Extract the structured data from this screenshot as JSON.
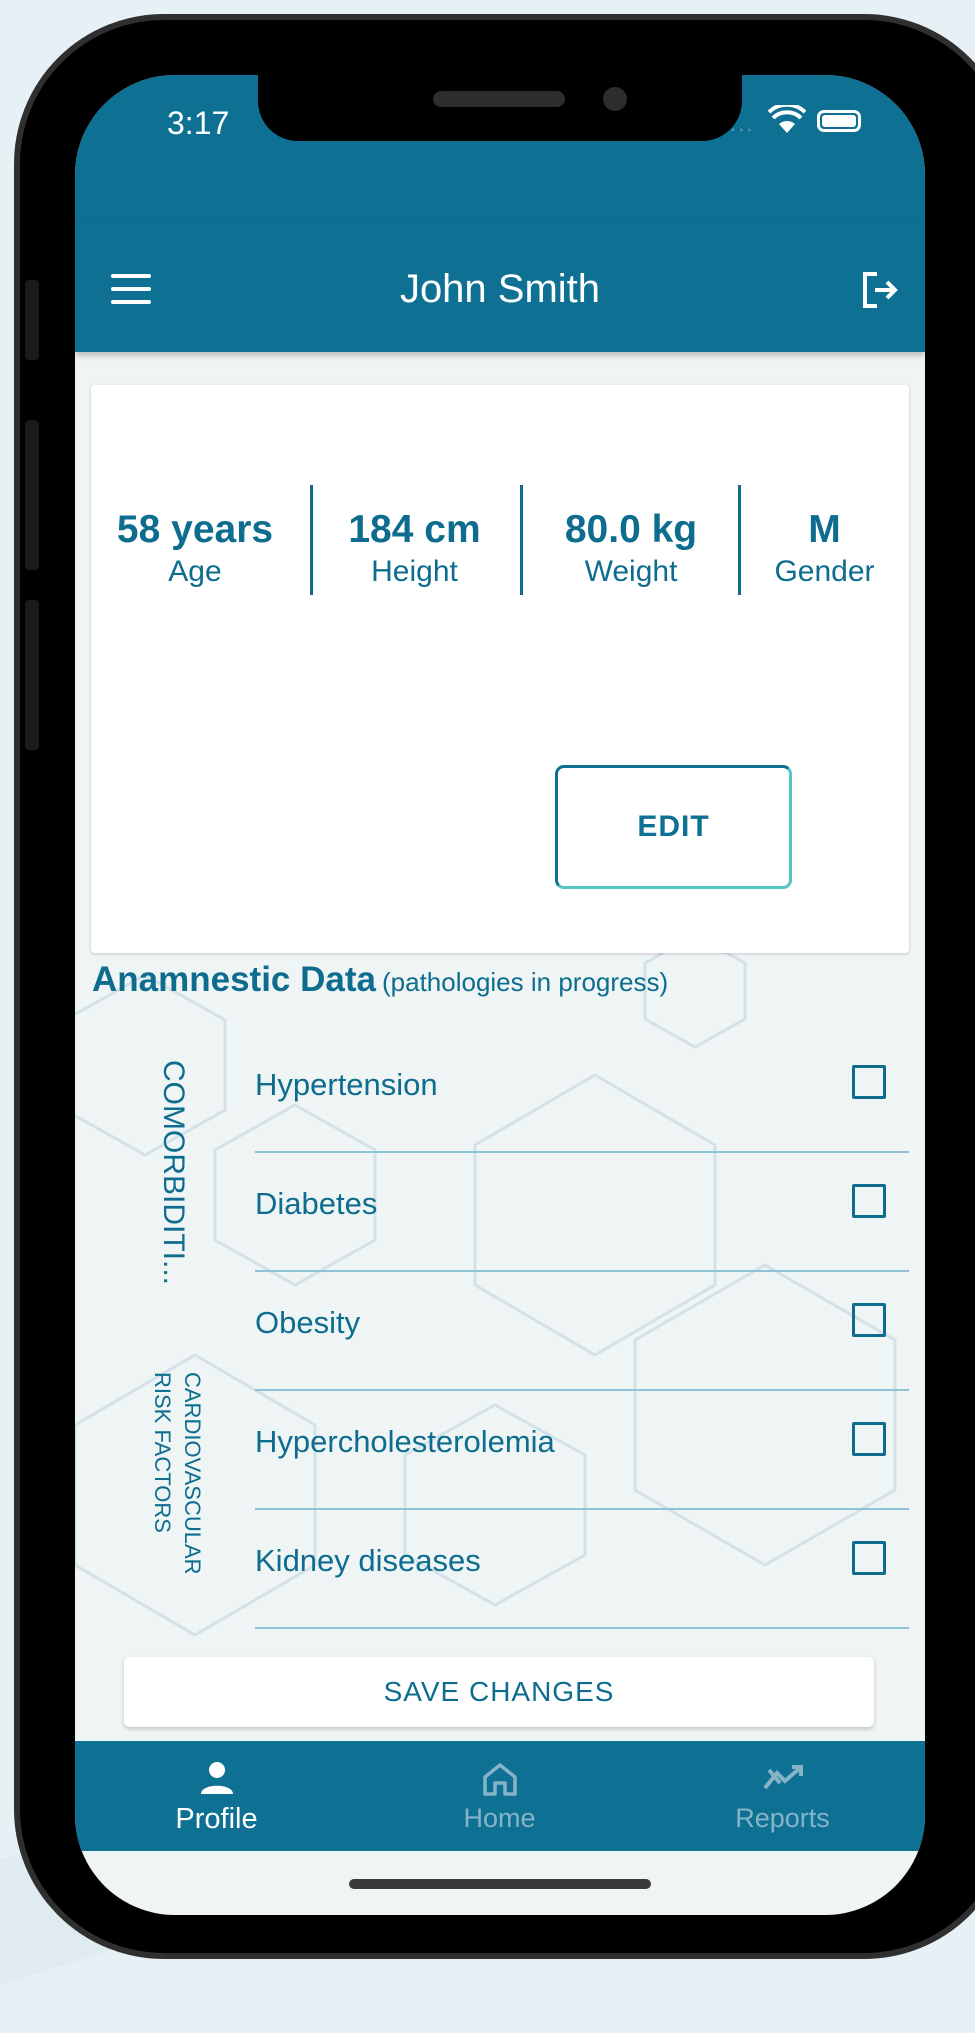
{
  "status_bar": {
    "time": "3:17",
    "signal": "..."
  },
  "header": {
    "title": "John Smith"
  },
  "profile": {
    "age": {
      "value": "58 years",
      "label": "Age"
    },
    "height": {
      "value": "184 cm",
      "label": "Height"
    },
    "weight": {
      "value": "80.0 kg",
      "label": "Weight"
    },
    "gender": {
      "value": "M",
      "label": "Gender"
    },
    "edit_label": "EDIT"
  },
  "anamnestic": {
    "title": "Anamnestic Data",
    "subtitle": "(pathologies in progress)",
    "group_comorbidities": "COMORBIDITI...",
    "group_risk": "CARDIOVASCULAR RISK FACTORS",
    "items": [
      {
        "label": "Hypertension",
        "checked": false
      },
      {
        "label": "Diabetes",
        "checked": false
      },
      {
        "label": "Obesity",
        "checked": false
      },
      {
        "label": "Hypercholesterolemia",
        "checked": false
      },
      {
        "label": "Kidney diseases",
        "checked": false
      }
    ],
    "save_label": "SAVE CHANGES"
  },
  "tabs": [
    {
      "label": "Profile",
      "icon": "person-icon",
      "active": true
    },
    {
      "label": "Home",
      "icon": "home-icon",
      "active": false
    },
    {
      "label": "Reports",
      "icon": "trend-icon",
      "active": false
    }
  ],
  "colors": {
    "primary": "#0e7194",
    "text": "#0e6d8e",
    "accent": "#53c6c4",
    "background": "#eff4f5"
  }
}
